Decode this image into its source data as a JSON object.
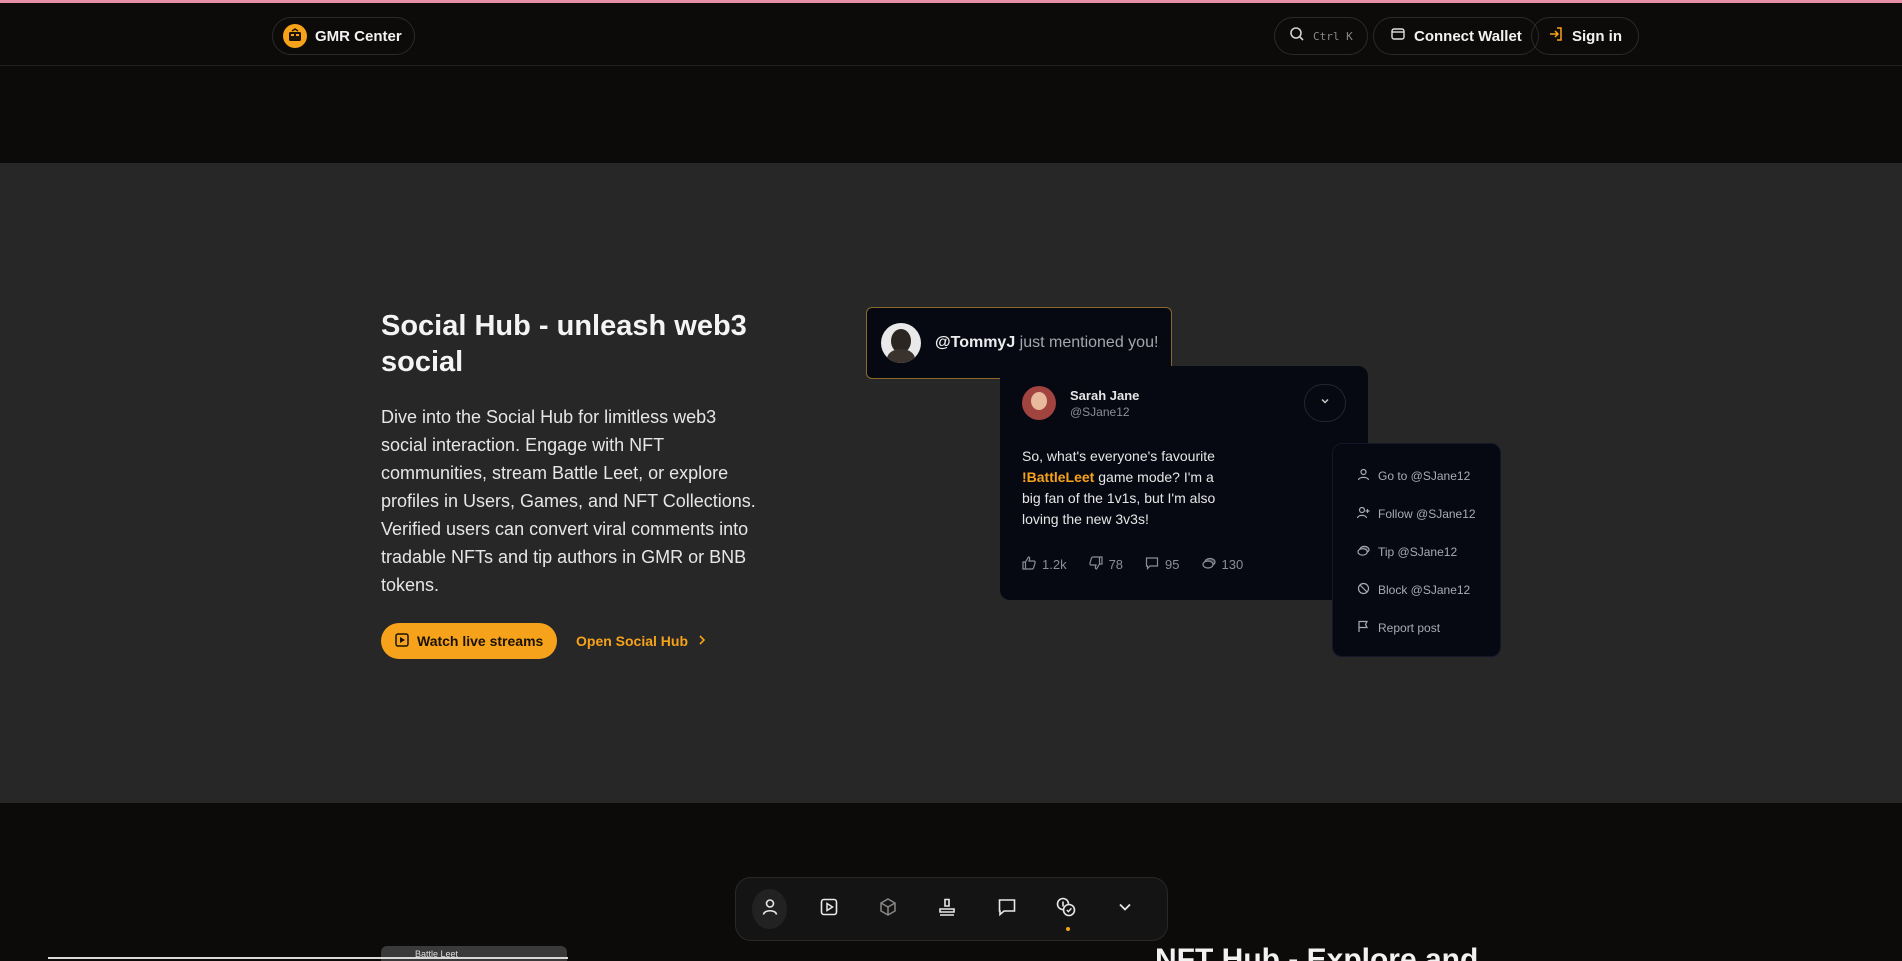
{
  "header": {
    "brand": "GMR Center",
    "search_shortcut": "Ctrl K",
    "connect_wallet": "Connect Wallet",
    "sign_in": "Sign in"
  },
  "hero": {
    "title": "Social Hub - unleash web3 social",
    "description": "Dive into the Social Hub for limitless web3 social interaction. Engage with NFT communities, stream Battle Leet, or explore profiles in Users, Games, and NFT Collections. Verified users can convert viral comments into tradable NFTs and tip authors in GMR or BNB tokens.",
    "primary_button": "Watch live streams",
    "secondary_link": "Open Social Hub"
  },
  "mention": {
    "user": "@TommyJ",
    "text": " just mentioned you!"
  },
  "post": {
    "name": "Sarah Jane",
    "handle": "@SJane12",
    "text_before": "So, what's everyone's favourite ",
    "highlight": "!BattleLeet",
    "text_after": " game mode? I'm a big fan of the 1v1s, but I'm also loving the new 3v3s!",
    "likes": "1.2k",
    "dislikes": "78",
    "comments": "95",
    "tips": "130"
  },
  "post_menu": {
    "items": [
      {
        "label": "Go to @SJane12",
        "icon": "user-icon"
      },
      {
        "label": "Follow @SJane12",
        "icon": "user-plus-icon"
      },
      {
        "label": "Tip @SJane12",
        "icon": "coin-icon"
      },
      {
        "label": "Block @SJane12",
        "icon": "block-icon"
      },
      {
        "label": "Report post",
        "icon": "flag-icon"
      }
    ]
  },
  "dock": {
    "items": [
      "user-icon",
      "play-icon",
      "cube-icon",
      "stamp-icon",
      "chat-icon",
      "coins-icon",
      "chevron-down-icon"
    ],
    "active_index": 0,
    "indicator_index": 5
  },
  "bottom": {
    "thumb_label": "Battle Leet",
    "section_title": "NFT Hub - Explore and"
  },
  "colors": {
    "accent": "#f7a21b",
    "hero_bg": "#272727",
    "page_bg": "#0d0b0a",
    "card_bg": "#070912"
  }
}
